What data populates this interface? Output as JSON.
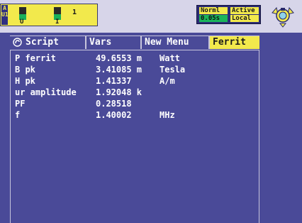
{
  "channel": {
    "label_line1": "A",
    "label_line2": "U1",
    "u_label": "U",
    "i_label": "I",
    "number": "1",
    "accent_color": "#f2e94c",
    "bar_color": "#19b05a"
  },
  "status": {
    "mode": "Norml",
    "state": "Active",
    "interval": "0.05s",
    "control": "Local"
  },
  "logo_icon": "analyzer-mascot-icon",
  "tabs": {
    "script": "Script",
    "vars": "Vars",
    "new_menu": "New Menu",
    "ferrit": "Ferrit",
    "script_icon": "script-circle-icon"
  },
  "rows": [
    {
      "name": "P ferrit",
      "value": "49.6553 m",
      "unit": "Watt"
    },
    {
      "name": "B pk",
      "value": "3.41085 m",
      "unit": "Tesla"
    },
    {
      "name": "H pk",
      "value": "1.41337",
      "unit": "A/m"
    },
    {
      "name": "ur amplitude",
      "value": "1.92048 k",
      "unit": ""
    },
    {
      "name": "PF",
      "value": "0.28518",
      "unit": ""
    },
    {
      "name": "f",
      "value": "1.40002",
      "unit": "MHz"
    }
  ]
}
